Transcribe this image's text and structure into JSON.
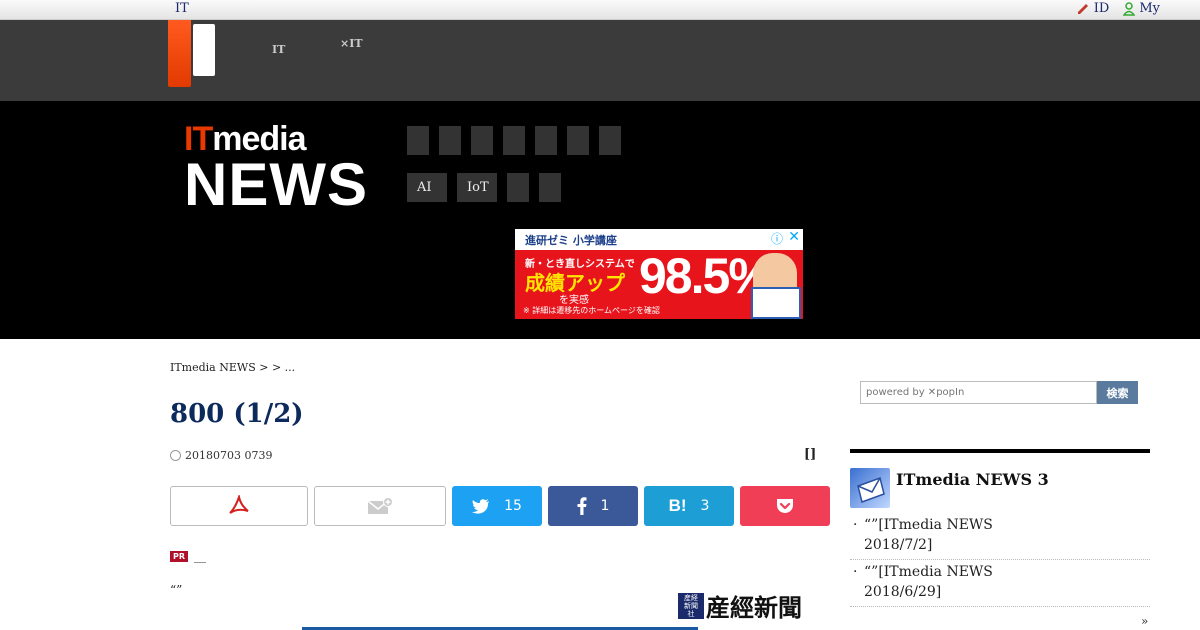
{
  "topbar": {
    "site_link": "IT",
    "id_link": "ID",
    "my_link": "My"
  },
  "portal": {
    "nav1_l1": "",
    "nav1_l2": "IT",
    "nav2_l1": "",
    "nav2_l2": "×IT"
  },
  "brand": {
    "line1": "ITmedia",
    "line2": "NEWS"
  },
  "menu": {
    "row1": [
      "",
      "",
      "",
      "",
      "",
      "",
      ""
    ],
    "row2": [
      "AI",
      "IoT",
      "",
      ""
    ]
  },
  "ad": {
    "heading": "進研ゼミ 小学講座",
    "line1": "新・とき直しシステムで",
    "line2": "成績アップ",
    "line3": "を実感",
    "number": "98.5%",
    "footnote": "※ 詳細は遷移先のホームページを確認",
    "close": "✕",
    "info": "ⓘ"
  },
  "article": {
    "breadcrumb": "ITmedia NEWS >  > ...",
    "title": "800 (1/2)",
    "date": "20180703 0739",
    "bracket": "[]",
    "pr_text": "__",
    "lead": "“”",
    "sankei": "産經新聞"
  },
  "share": {
    "twitter_count": "15",
    "facebook_count": "1",
    "hatena_label": "B!",
    "hatena_count": "3"
  },
  "sidebar": {
    "search_placeholder": "powered by ✕popIn",
    "search_button": "検索",
    "section_title": "ITmedia NEWS 3",
    "items": [
      {
        "line1": "“”[ITmedia NEWS",
        "line2": "2018/7/2]"
      },
      {
        "line1": "“”[ITmedia NEWS",
        "line2": "2018/6/29]"
      }
    ],
    "more": "»"
  },
  "colors": {
    "brand_orange": "#e83a00",
    "twitter": "#1da1f2",
    "facebook": "#3b5998",
    "hatena": "#1d9fd6",
    "pocket": "#ef3e56"
  }
}
